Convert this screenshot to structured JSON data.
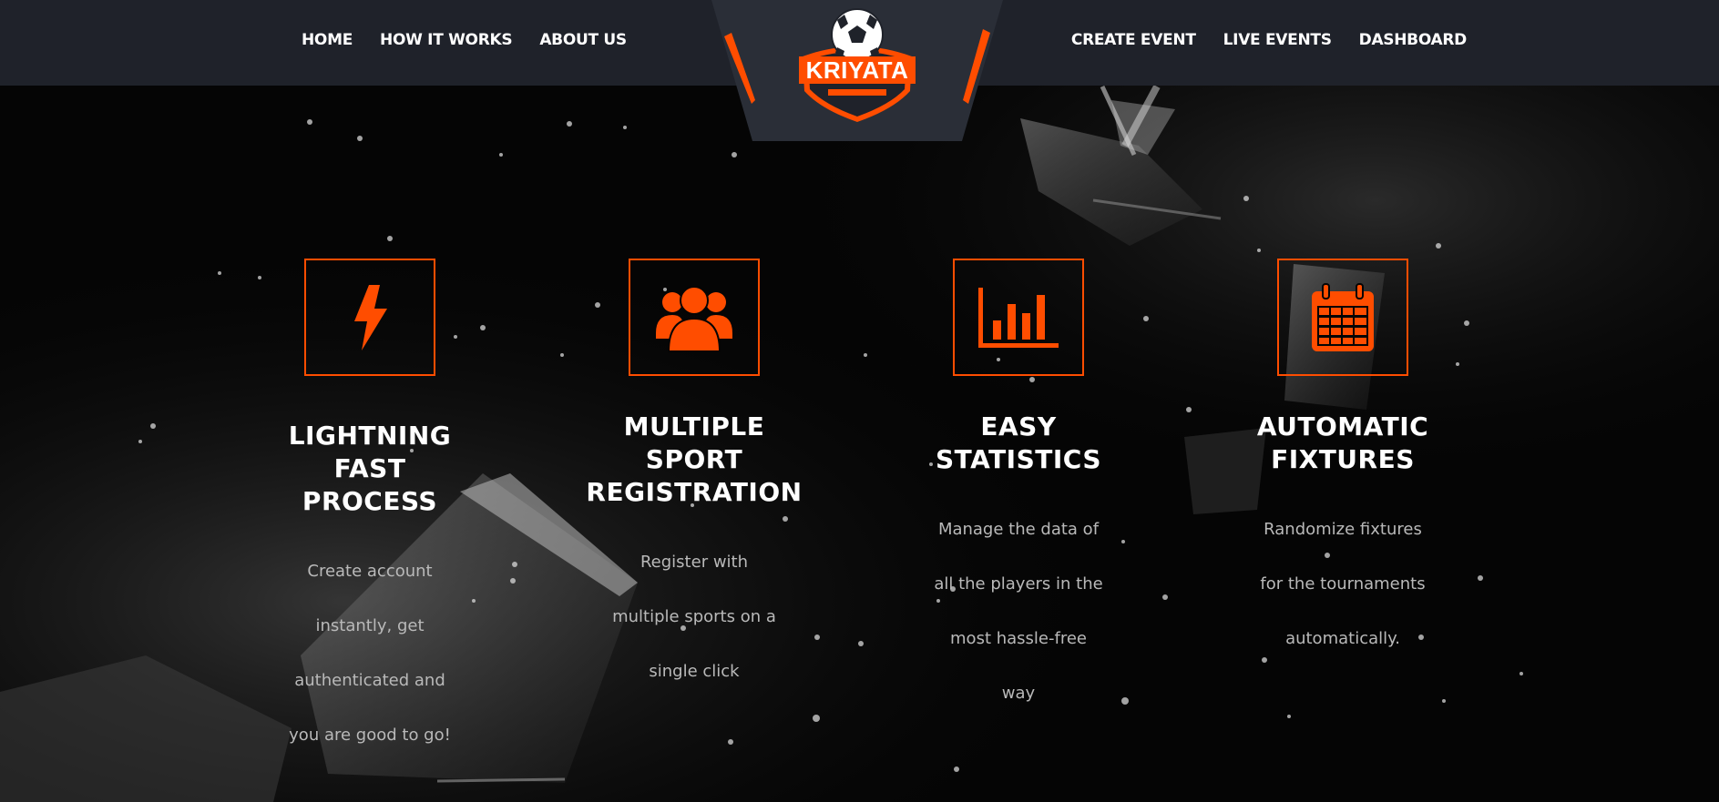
{
  "nav": {
    "left": [
      {
        "label": "HOME"
      },
      {
        "label": "HOW IT WORKS"
      },
      {
        "label": "ABOUT US"
      }
    ],
    "right": [
      {
        "label": "CREATE EVENT"
      },
      {
        "label": "LIVE EVENTS"
      },
      {
        "label": "DASHBOARD"
      }
    ]
  },
  "logo": {
    "text": "KRIYATA",
    "icon": "soccer-ball-shield-icon"
  },
  "colors": {
    "accent": "#ff4d00",
    "header_bg": "#1f222a",
    "page_bg": "#050505",
    "title": "#ffffff",
    "desc": "#b9b9b9"
  },
  "features": [
    {
      "icon": "lightning-bolt-icon",
      "title": "LIGHTNING\nFAST\nPROCESS",
      "title_lines": [
        "LIGHTNING",
        "FAST",
        "PROCESS"
      ],
      "desc_lines": [
        "Create account",
        "instantly, get",
        "authenticated and",
        "you are good to go!"
      ]
    },
    {
      "icon": "group-users-icon",
      "title_lines": [
        "MULTIPLE",
        "SPORT",
        "REGISTRATION"
      ],
      "desc_lines": [
        "Register with",
        "multiple sports on a",
        "single click"
      ]
    },
    {
      "icon": "bar-chart-icon",
      "title_lines": [
        "EASY",
        "STATISTICS"
      ],
      "desc_lines": [
        "Manage the data of",
        "all the players in the",
        "most hassle-free",
        "way"
      ]
    },
    {
      "icon": "calendar-icon",
      "title_lines": [
        "AUTOMATIC",
        "FIXTURES"
      ],
      "desc_lines": [
        "Randomize fixtures",
        "for the tournaments",
        "automatically."
      ]
    }
  ]
}
